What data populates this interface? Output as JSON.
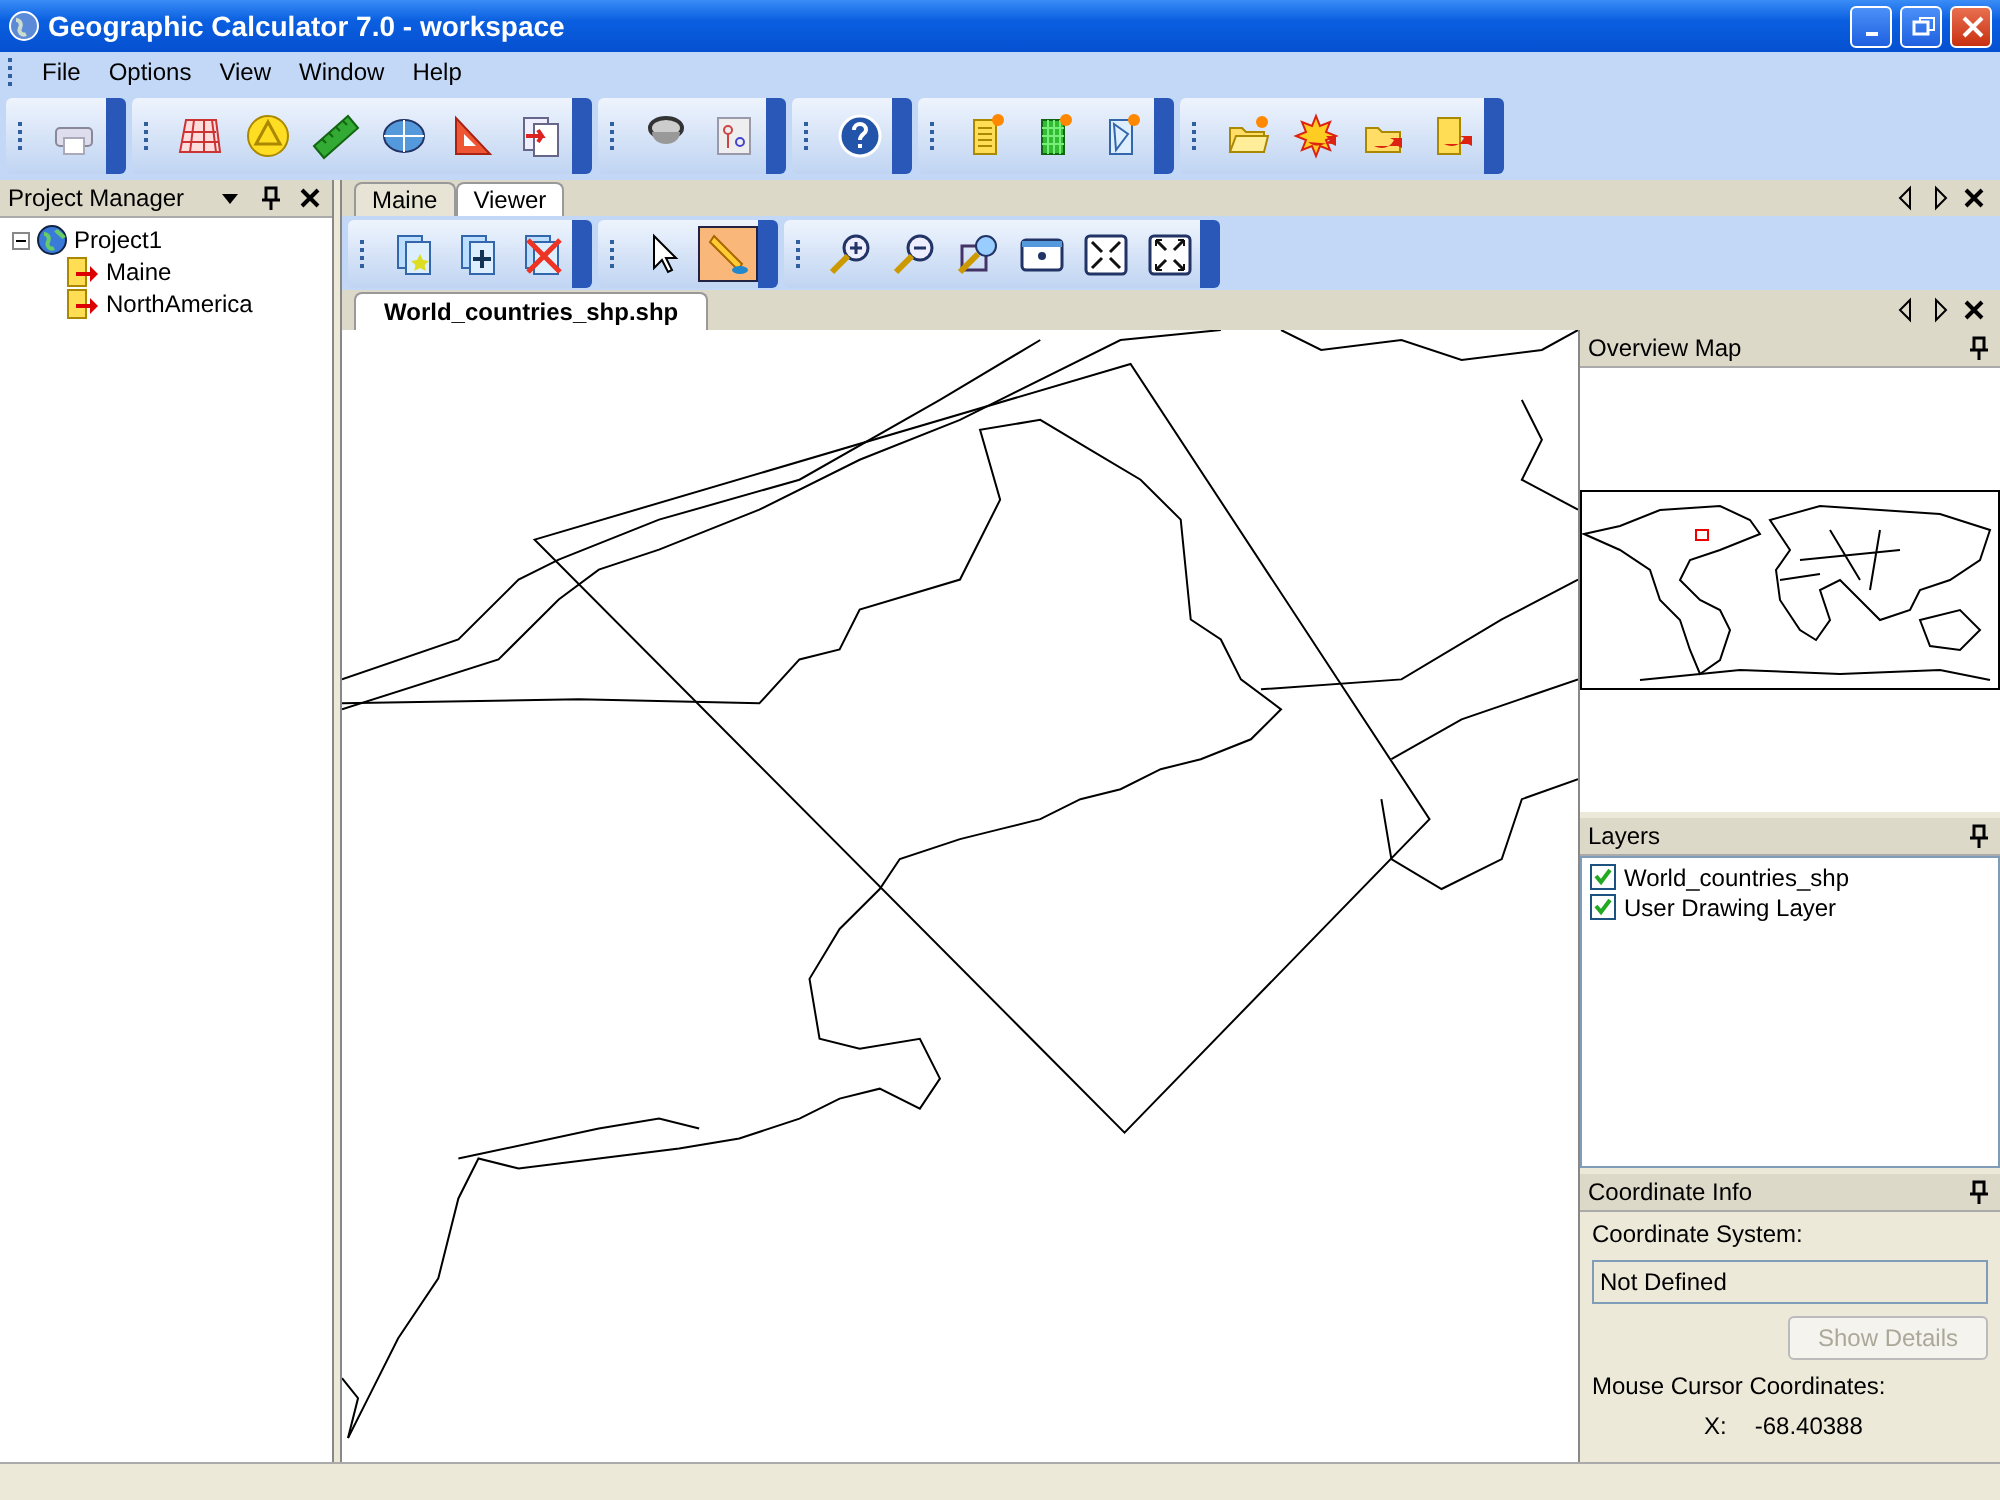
{
  "window": {
    "title": "Geographic Calculator 7.0 - workspace"
  },
  "menu": [
    "File",
    "Options",
    "View",
    "Window",
    "Help"
  ],
  "main_toolbar": [
    {
      "tools": [
        {
          "kind": "print"
        }
      ]
    },
    {
      "tools": [
        {
          "kind": "grid"
        },
        {
          "kind": "triangle"
        },
        {
          "kind": "ruler"
        },
        {
          "kind": "ellipsoid"
        },
        {
          "kind": "setsquare"
        },
        {
          "kind": "convert"
        }
      ]
    },
    {
      "tools": [
        {
          "kind": "lens"
        },
        {
          "kind": "points"
        }
      ]
    },
    {
      "tools": [
        {
          "kind": "help"
        }
      ]
    },
    {
      "tools": [
        {
          "kind": "newdoc"
        },
        {
          "kind": "newgrid"
        },
        {
          "kind": "newshape"
        }
      ]
    },
    {
      "tools": [
        {
          "kind": "openfolder"
        },
        {
          "kind": "burst"
        },
        {
          "kind": "folderarrow"
        },
        {
          "kind": "docarrow"
        }
      ]
    }
  ],
  "project_manager": {
    "title": "Project Manager",
    "tree": [
      {
        "label": "Project1",
        "expanded": true,
        "children": [
          {
            "label": "Maine"
          },
          {
            "label": "NorthAmerica"
          }
        ]
      }
    ]
  },
  "view_tabs": [
    {
      "label": "Maine",
      "selected": false
    },
    {
      "label": "Viewer",
      "selected": true
    }
  ],
  "viewer_toolbar": [
    {
      "tools": [
        {
          "kind": "addlayer",
          "selected": false
        },
        {
          "kind": "newlayer",
          "selected": false
        },
        {
          "kind": "removelayer",
          "selected": false
        }
      ]
    },
    {
      "tools": [
        {
          "kind": "pointer",
          "selected": false
        },
        {
          "kind": "pencil",
          "selected": true
        }
      ]
    },
    {
      "tools": [
        {
          "kind": "zoomin",
          "selected": false
        },
        {
          "kind": "zoomout",
          "selected": false
        },
        {
          "kind": "zoombox",
          "selected": false
        },
        {
          "kind": "center",
          "selected": false
        },
        {
          "kind": "fitin",
          "selected": false
        },
        {
          "kind": "fitout",
          "selected": false
        }
      ]
    }
  ],
  "document_tab": {
    "label": "World_countries_shp.shp"
  },
  "overview_map": {
    "title": "Overview Map"
  },
  "layers": {
    "title": "Layers",
    "items": [
      {
        "label": "World_countries_shp",
        "checked": true
      },
      {
        "label": "User Drawing Layer",
        "checked": true
      }
    ]
  },
  "coordinate_info": {
    "title": "Coordinate Info",
    "system_label": "Coordinate System:",
    "system_value": "Not Defined",
    "button": {
      "label": "Show Details",
      "disabled": true
    },
    "cursor_label": "Mouse Cursor Coordinates:",
    "x_label": "X:",
    "x_value": "-68.40388"
  }
}
